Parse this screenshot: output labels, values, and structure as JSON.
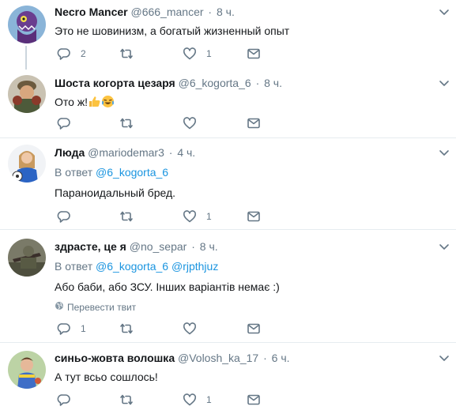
{
  "tweets": [
    {
      "name": "Necro Mancer",
      "handle": "@666_mancer",
      "time": "8 ч.",
      "text": "Это не шовинизм, а богатый жизненный опыт",
      "reply_count": "2",
      "retweet_count": "",
      "like_count": "1"
    },
    {
      "name": "Шоста когорта цезаря",
      "handle": "@6_kogorta_6",
      "time": "8 ч.",
      "text": "Ото ж!",
      "reply_count": "",
      "retweet_count": "",
      "like_count": ""
    },
    {
      "name": "Люда",
      "handle": "@mariodemar3",
      "time": "4 ч.",
      "reply_prefix": "В ответ",
      "reply_user": "@6_kogorta_6",
      "text": "Параноидальный бред.",
      "reply_count": "",
      "retweet_count": "",
      "like_count": "1"
    },
    {
      "name": "здрасте, це я",
      "handle": "@no_separ",
      "time": "8 ч.",
      "reply_prefix": "В ответ",
      "reply_user": "@6_kogorta_6",
      "reply_user_2": "@rjpthjuz",
      "text": "Або баби, або ЗСУ. Інших варіантів немає :)",
      "translate_label": "Перевести твит",
      "reply_count": "1",
      "retweet_count": "",
      "like_count": ""
    },
    {
      "name": "синьо-жовта волошка",
      "handle": "@Volosh_ka_17",
      "time": "6 ч.",
      "text": "А тут всьо сошлось!",
      "reply_count": "",
      "retweet_count": "",
      "like_count": "1"
    }
  ],
  "separator": "·",
  "colors": {
    "text": "#14171a",
    "secondary": "#657786",
    "link": "#1b95e0",
    "border": "#e6ecf0",
    "thread_line": "#ccd6dd"
  },
  "icons": {
    "reply": "reply-icon",
    "retweet": "retweet-icon",
    "like": "heart-icon",
    "dm": "envelope-icon",
    "caret": "chevron-down-icon",
    "globe": "globe-icon"
  }
}
